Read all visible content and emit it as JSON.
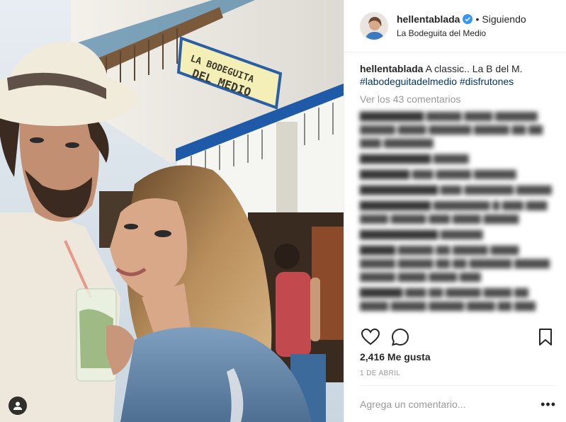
{
  "post": {
    "username": "hellentablada",
    "verified": true,
    "follow_status": "Siguiendo",
    "location": "La Bodeguita del Medio",
    "sign_text": [
      "LA BODEGUITA",
      "DEL MEDIO"
    ],
    "caption": {
      "text": "A classic.. La B del M.",
      "hashtags": [
        "#labodeguitadelmedio",
        "#disfrutones"
      ]
    },
    "view_all_comments": "Ver los 43 comentarios",
    "likes": "2,416 Me gusta",
    "date": "1 DE ABRIL",
    "comment_placeholder": "Agrega un comentario..."
  },
  "icons": {
    "like": "heart-icon",
    "comment": "comment-icon",
    "save": "bookmark-icon",
    "more": "more-options-icon",
    "tag": "user-tag-icon",
    "verified": "verified-badge-icon"
  },
  "colors": {
    "text": "#262626",
    "hashtag": "#003569",
    "muted": "#999999",
    "verified": "#3897f0",
    "border": "#efefef"
  }
}
